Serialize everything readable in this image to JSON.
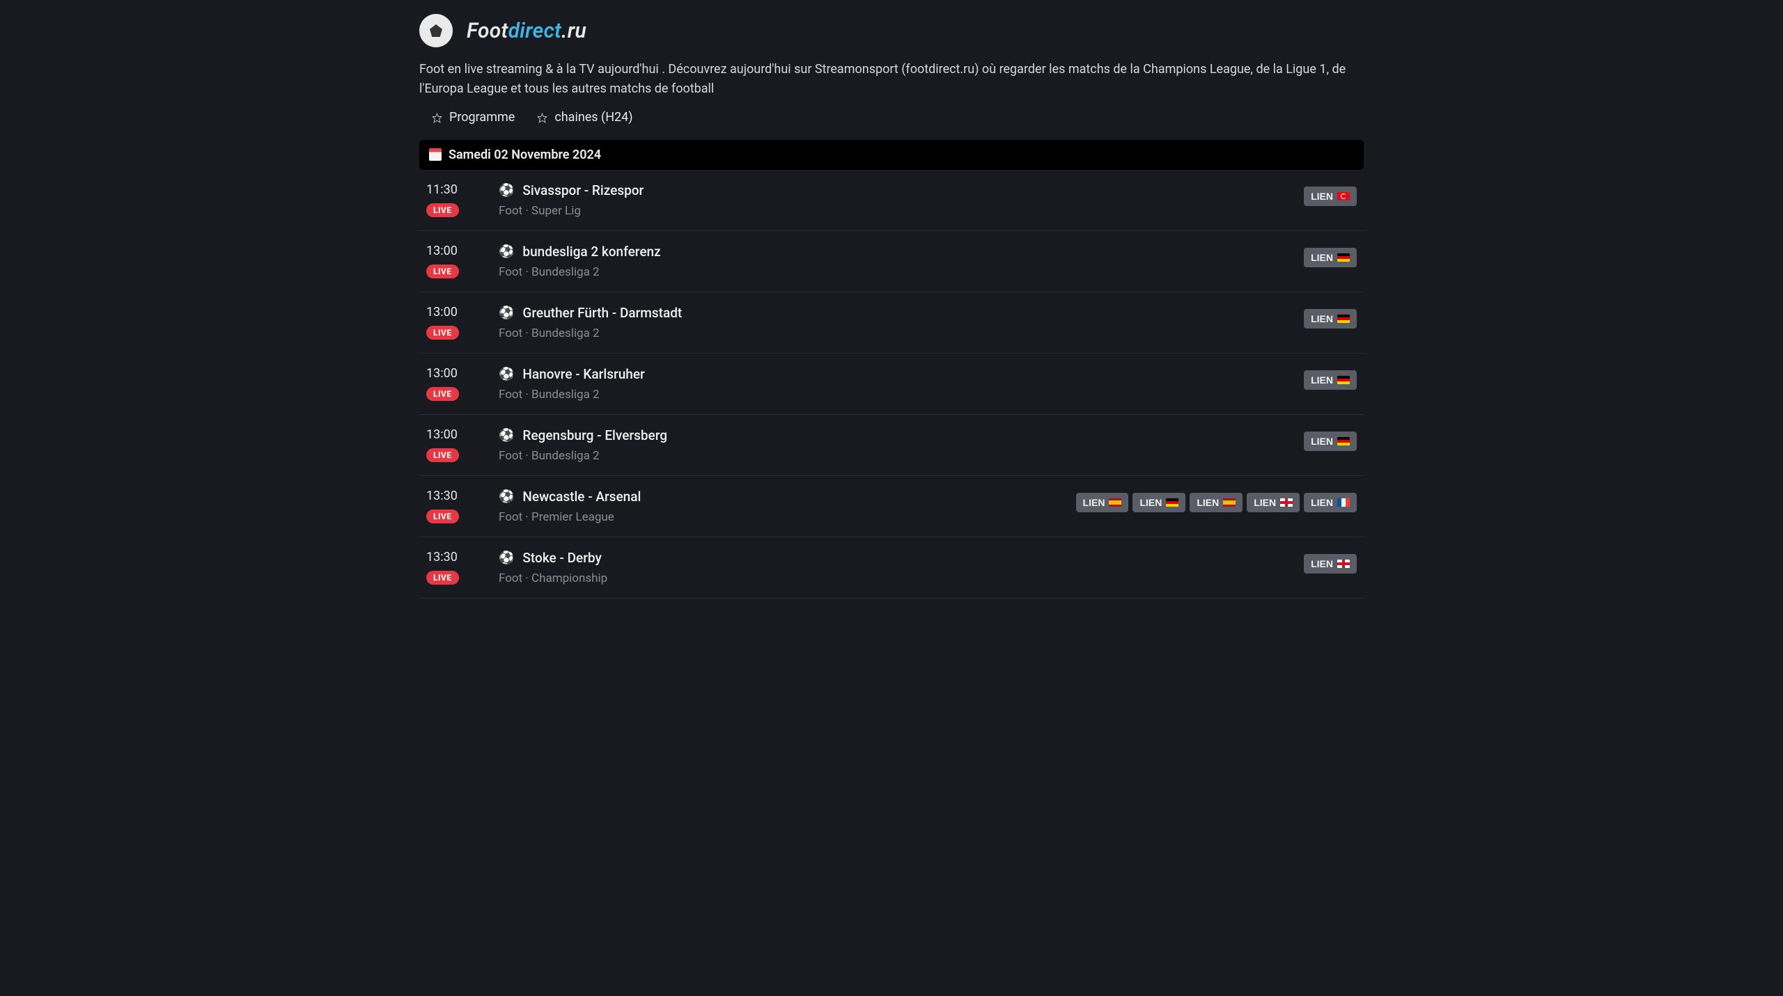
{
  "logo": {
    "part1": "Foot",
    "part2": "direct",
    "part3": ".ru"
  },
  "description": "Foot en live streaming & à la TV aujourd'hui . Découvrez aujourd'hui sur Streamonsport (footdirect.ru) où regarder les matchs de la Champions League, de la Ligue 1, de l'Europa League et tous les autres matchs de football",
  "nav": {
    "programme": "Programme",
    "chaines": "chaines (H24)"
  },
  "date_header": "Samedi 02 Novembre 2024",
  "live_label": "LIVE",
  "lien_label": "LIEN",
  "matches": [
    {
      "time": "11:30",
      "title": "Sivasspor - Rizespor",
      "sub": "Foot · Super Lig",
      "links": [
        "tr"
      ]
    },
    {
      "time": "13:00",
      "title": "bundesliga 2 konferenz",
      "sub": "Foot · Bundesliga 2",
      "links": [
        "de"
      ]
    },
    {
      "time": "13:00",
      "title": "Greuther Fürth - Darmstadt",
      "sub": "Foot · Bundesliga 2",
      "links": [
        "de"
      ]
    },
    {
      "time": "13:00",
      "title": "Hanovre - Karlsruher",
      "sub": "Foot · Bundesliga 2",
      "links": [
        "de"
      ]
    },
    {
      "time": "13:00",
      "title": "Regensburg - Elversberg",
      "sub": "Foot · Bundesliga 2",
      "links": [
        "de"
      ]
    },
    {
      "time": "13:30",
      "title": "Newcastle - Arsenal",
      "sub": "Foot · Premier League",
      "links": [
        "es",
        "de",
        "es",
        "en",
        "fr"
      ]
    },
    {
      "time": "13:30",
      "title": "Stoke - Derby",
      "sub": "Foot · Championship",
      "links": [
        "en"
      ]
    }
  ]
}
